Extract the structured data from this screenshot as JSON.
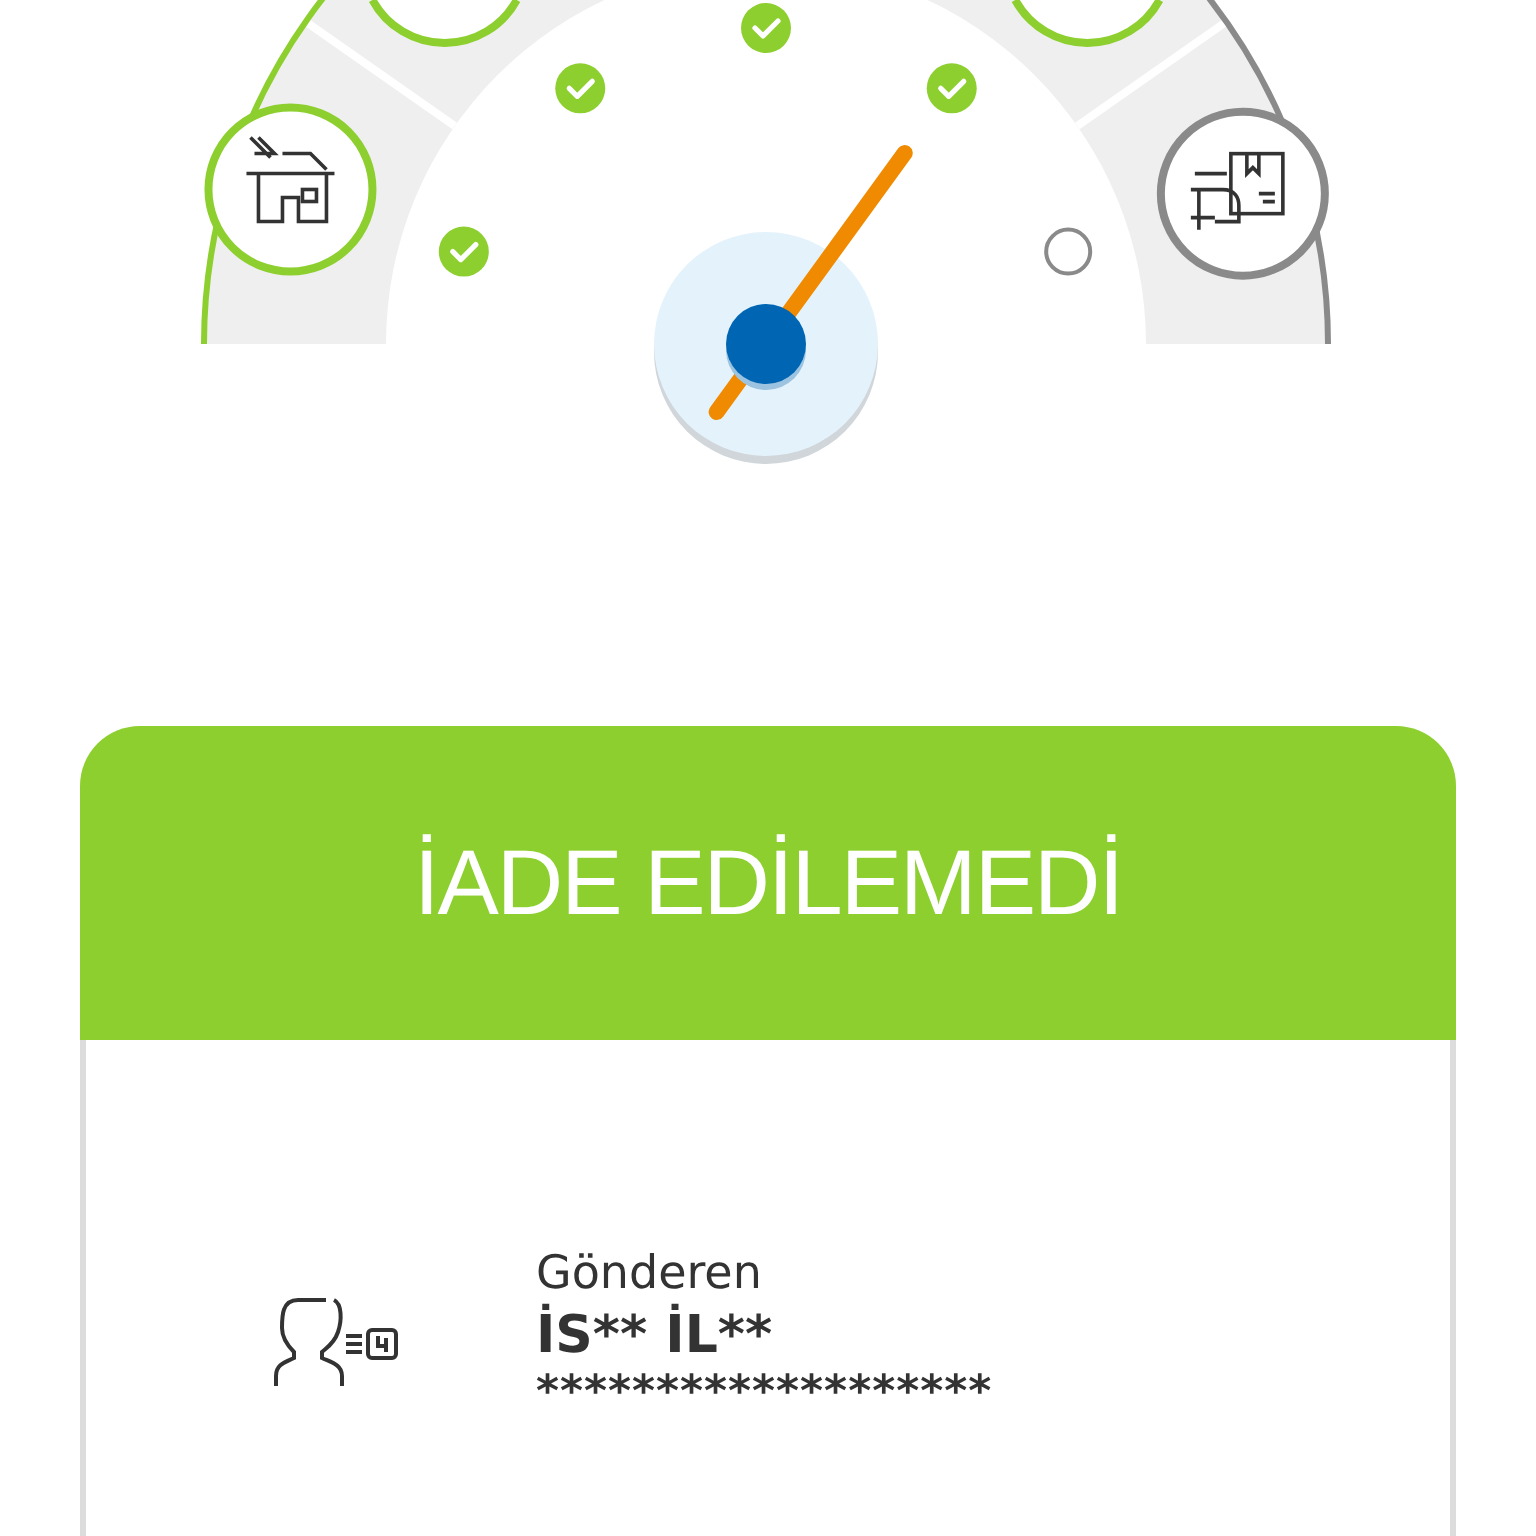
{
  "tracker": {
    "stages": [
      {
        "kind": "house",
        "done": true
      },
      {
        "kind": "partial",
        "done": true
      },
      {
        "kind": "partial",
        "done": true
      },
      {
        "kind": "handover",
        "done": false
      }
    ],
    "checkpoints": [
      {
        "done": true
      },
      {
        "done": true
      },
      {
        "done": true
      },
      {
        "done": true
      },
      {
        "done": false
      }
    ]
  },
  "status": {
    "title": "İADE EDİLEMEDİ"
  },
  "sender": {
    "label": "Gönderen",
    "name": "İS** İL**",
    "detail": "*******************"
  }
}
